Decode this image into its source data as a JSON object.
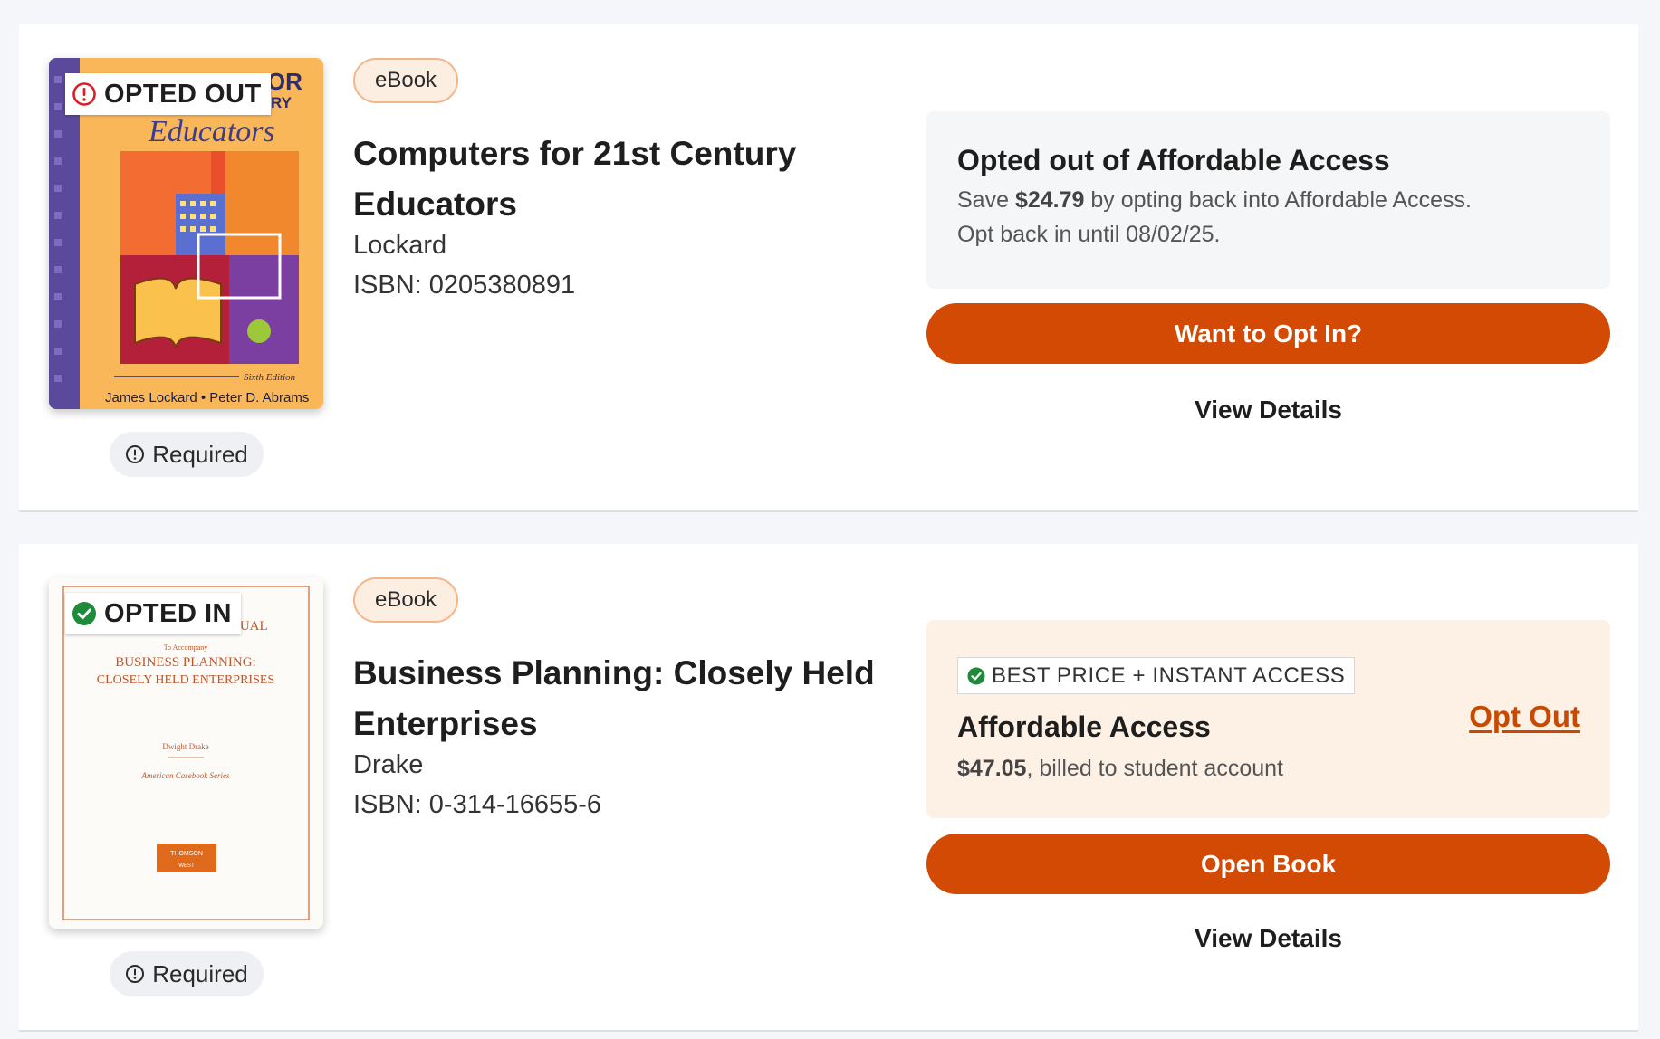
{
  "books": [
    {
      "status": "OPTED OUT",
      "status_color": "#d71f2b",
      "format": "eBook",
      "title": "Computers for 21st Century Educators",
      "author": "Lockard",
      "isbn": "ISBN: 0205380891",
      "requirement": "Required",
      "cover": {
        "top_text": "COMPUTERS FOR",
        "sub_text": "NTURY",
        "script_title": "Educators",
        "edition": "Sixth Edition",
        "authors": "James Lockard • Peter D. Abrams"
      },
      "panel": {
        "title": "Opted out of Affordable Access",
        "line1_prefix": "Save ",
        "line1_amount": "$24.79",
        "line1_suffix": " by opting back into Affordable Access.",
        "line2": "Opt back in until 08/02/25."
      },
      "primary_button": "Want to Opt In?",
      "details_link": "View Details"
    },
    {
      "status": "OPTED IN",
      "status_color": "#1f8a3a",
      "format": "eBook",
      "title": "Business Planning: Closely Held Enterprises",
      "author": "Drake",
      "isbn": "ISBN: 0-314-16655-6",
      "requirement": "Required",
      "cover": {
        "line1": "NUAL",
        "line2": "To Accompany",
        "line3": "BUSINESS PLANNING:",
        "line4": "CLOSELY HELD ENTERPRISES",
        "author": "Dwight Drake",
        "series": "American Casebook Series",
        "publisher1": "THOMSON",
        "publisher2": "WEST"
      },
      "panel": {
        "badge": "BEST PRICE + INSTANT ACCESS",
        "title": "Affordable Access",
        "price": "$47.05",
        "price_suffix": ", billed to student account",
        "opt_out": "Opt Out"
      },
      "primary_button": "Open Book",
      "details_link": "View Details"
    }
  ],
  "colors": {
    "accent": "#d24a04",
    "link": "#c84a00",
    "chip_border": "#f3b58a",
    "chip_bg": "#fdeee2"
  }
}
